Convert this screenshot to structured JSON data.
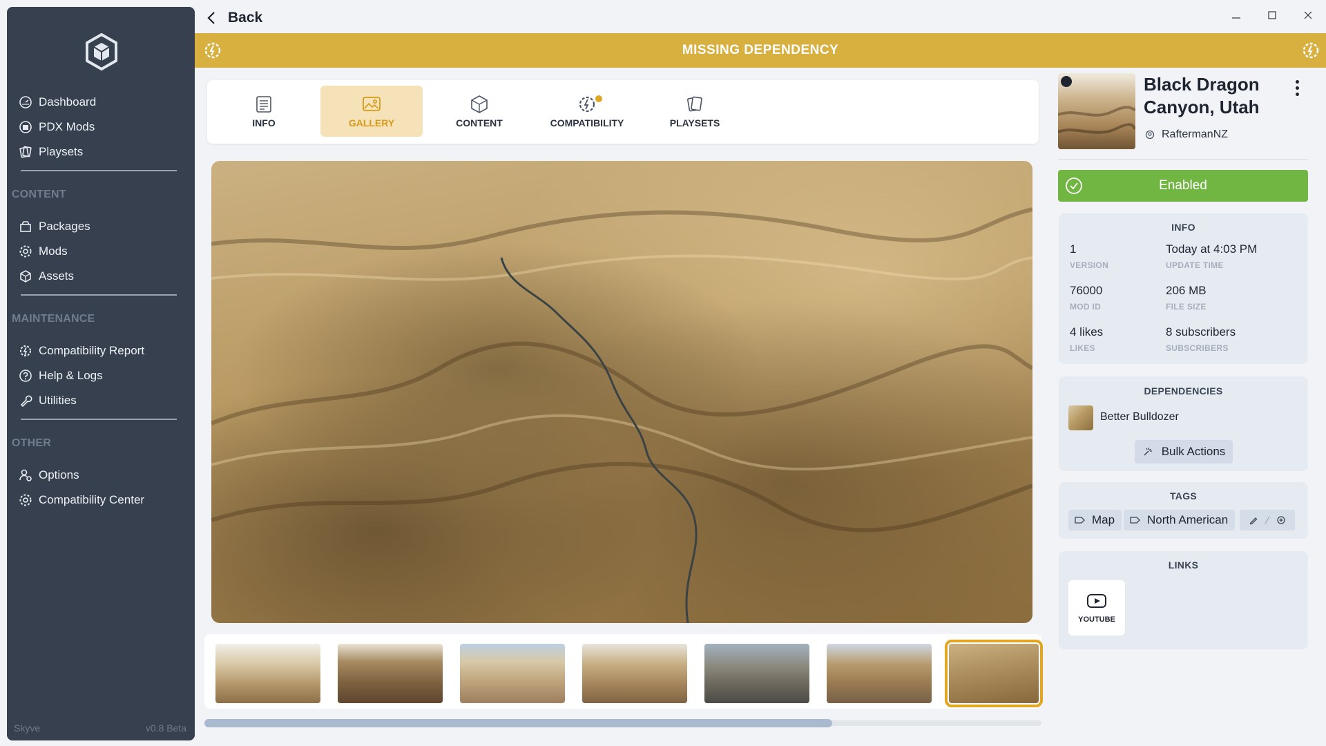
{
  "sidebar": {
    "nav_top": [
      {
        "label": "Dashboard",
        "icon": "dashboard-icon"
      },
      {
        "label": "PDX Mods",
        "icon": "pdx-mods-icon"
      },
      {
        "label": "Playsets",
        "icon": "playsets-icon"
      }
    ],
    "content_heading": "CONTENT",
    "content_items": [
      {
        "label": "Packages",
        "icon": "package-icon"
      },
      {
        "label": "Mods",
        "icon": "gear-icon"
      },
      {
        "label": "Assets",
        "icon": "cube-icon"
      }
    ],
    "maintenance_heading": "MAINTENANCE",
    "maintenance_items": [
      {
        "label": "Compatibility Report",
        "icon": "compatibility-icon"
      },
      {
        "label": "Help & Logs",
        "icon": "help-icon"
      },
      {
        "label": "Utilities",
        "icon": "wrench-icon"
      }
    ],
    "other_heading": "OTHER",
    "other_items": [
      {
        "label": "Options",
        "icon": "user-settings-icon"
      },
      {
        "label": "Compatibility Center",
        "icon": "gear-icon"
      }
    ],
    "app_name": "Skyve",
    "version": "v0.8 Beta"
  },
  "header": {
    "back_label": "Back",
    "banner_text": "MISSING DEPENDENCY",
    "banner_color": "#d8b040"
  },
  "tabs": [
    {
      "label": "INFO",
      "icon": "info-icon"
    },
    {
      "label": "GALLERY",
      "icon": "gallery-icon",
      "active": true
    },
    {
      "label": "CONTENT",
      "icon": "cube-icon"
    },
    {
      "label": "COMPATIBILITY",
      "icon": "compatibility-icon"
    },
    {
      "label": "PLAYSETS",
      "icon": "playsets-icon"
    }
  ],
  "gallery": {
    "thumbnail_count": 7,
    "selected_index": 6,
    "scroll_fraction": 0.75
  },
  "mod": {
    "title_line1": "Black Dragon",
    "title_line2": "Canyon, Utah",
    "author": "RaftermanNZ",
    "status": "Enabled",
    "status_color": "#71b543"
  },
  "info": {
    "heading": "INFO",
    "version_value": "1",
    "version_label": "VERSION",
    "update_value": "Today at 4:03 PM",
    "update_label": "UPDATE TIME",
    "modid_value": "76000",
    "modid_label": "MOD ID",
    "filesize_value": "206 MB",
    "filesize_label": "FILE SIZE",
    "likes_value": "4 likes",
    "likes_label": "LIKES",
    "subs_value": "8 subscribers",
    "subs_label": "SUBSCRIBERS"
  },
  "dependencies": {
    "heading": "DEPENDENCIES",
    "items": [
      {
        "name": "Better Bulldozer"
      }
    ],
    "bulk_label": "Bulk Actions"
  },
  "tags": {
    "heading": "TAGS",
    "items": [
      "Map",
      "North American"
    ]
  },
  "links": {
    "heading": "LINKS",
    "youtube_label": "YOUTUBE"
  }
}
